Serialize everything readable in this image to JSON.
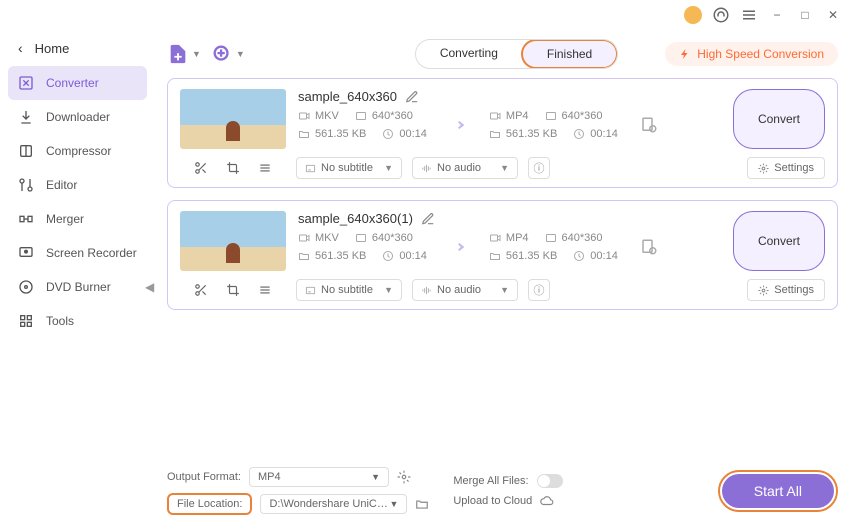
{
  "titlebar": {
    "minimize": "−",
    "maximize": "□",
    "close": "✕"
  },
  "sidebar": {
    "home": "Home",
    "items": [
      {
        "label": "Converter"
      },
      {
        "label": "Downloader"
      },
      {
        "label": "Compressor"
      },
      {
        "label": "Editor"
      },
      {
        "label": "Merger"
      },
      {
        "label": "Screen Recorder"
      },
      {
        "label": "DVD Burner"
      },
      {
        "label": "Tools"
      }
    ]
  },
  "toolbar": {
    "tabs": {
      "converting": "Converting",
      "finished": "Finished"
    },
    "high_speed": "High Speed Conversion"
  },
  "files": [
    {
      "name": "sample_640x360",
      "src": {
        "format": "MKV",
        "resolution": "640*360",
        "size": "561.35 KB",
        "duration": "00:14"
      },
      "dst": {
        "format": "MP4",
        "resolution": "640*360",
        "size": "561.35 KB",
        "duration": "00:14"
      },
      "subtitle": "No subtitle",
      "audio": "No audio",
      "settings": "Settings",
      "convert": "Convert"
    },
    {
      "name": "sample_640x360(1)",
      "src": {
        "format": "MKV",
        "resolution": "640*360",
        "size": "561.35 KB",
        "duration": "00:14"
      },
      "dst": {
        "format": "MP4",
        "resolution": "640*360",
        "size": "561.35 KB",
        "duration": "00:14"
      },
      "subtitle": "No subtitle",
      "audio": "No audio",
      "settings": "Settings",
      "convert": "Convert"
    }
  ],
  "footer": {
    "output_format_label": "Output Format:",
    "output_format_value": "MP4",
    "file_location_label": "File Location:",
    "file_location_value": "D:\\Wondershare UniConverter 1",
    "merge_label": "Merge All Files:",
    "cloud_label": "Upload to Cloud",
    "start_all": "Start All"
  }
}
